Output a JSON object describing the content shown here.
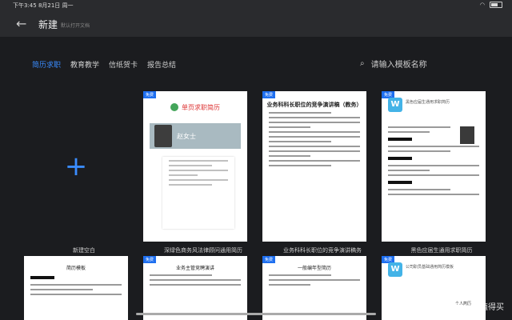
{
  "status": {
    "time": "下午3:45 8月21日 周一"
  },
  "header": {
    "title": "新建",
    "subtitle": "默认打开文档"
  },
  "tabs": [
    "简历求职",
    "教育教学",
    "信纸贺卡",
    "报告总结"
  ],
  "search": {
    "placeholder": "请输入模板名称"
  },
  "new_label": "新建空白",
  "badge": "免费",
  "cards": [
    {
      "name": "深绿色商务风法律顾问通用简历",
      "doc_name": "赵女士",
      "doc_title": "单页求职简历"
    },
    {
      "name": "业务科科长职位的竞争演讲稿务",
      "doc_title": "业务科科长职位的竞争演讲稿（教务）"
    },
    {
      "name": "黑色应届生通用求职简历",
      "doc_title": "黑色应届生通用求职简历"
    }
  ],
  "row2": [
    {
      "doc_title": "简历模板"
    },
    {
      "doc_title": "业务主管竞聘演讲"
    },
    {
      "doc_title": "一般编年型简历"
    },
    {
      "doc_title": "公司职员基础通用简历模板",
      "section": "个人简历"
    }
  ],
  "watermark": "值 什么值得买"
}
